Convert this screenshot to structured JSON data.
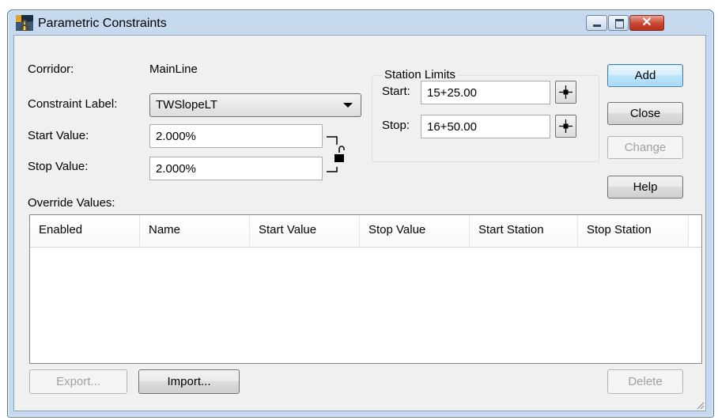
{
  "window": {
    "title": "Parametric Constraints",
    "app_icon": "road-icon"
  },
  "corridor": {
    "label": "Corridor:",
    "value": "MainLine"
  },
  "constraint_label": {
    "label": "Constraint Label:",
    "value": "TWSlopeLT"
  },
  "start_value": {
    "label": "Start Value:",
    "value": "2.000%"
  },
  "stop_value": {
    "label": "Stop Value:",
    "value": "2.000%"
  },
  "station_limits": {
    "title": "Station Limits",
    "start_label": "Start:",
    "start_value": "15+25.00",
    "stop_label": "Stop:",
    "stop_value": "16+50.00"
  },
  "buttons": {
    "add": "Add",
    "close": "Close",
    "change": "Change",
    "help": "Help",
    "export": "Export...",
    "import": "Import...",
    "delete": "Delete"
  },
  "override": {
    "label": "Override Values:",
    "columns": [
      "Enabled",
      "Name",
      "Start Value",
      "Stop Value",
      "Start Station",
      "Stop Station"
    ],
    "rows": []
  },
  "colors": {
    "titlebar": "#c6d9ee",
    "client": "#f0f0f0",
    "default_button": "#bee6fd",
    "close_button": "#c8452f"
  }
}
